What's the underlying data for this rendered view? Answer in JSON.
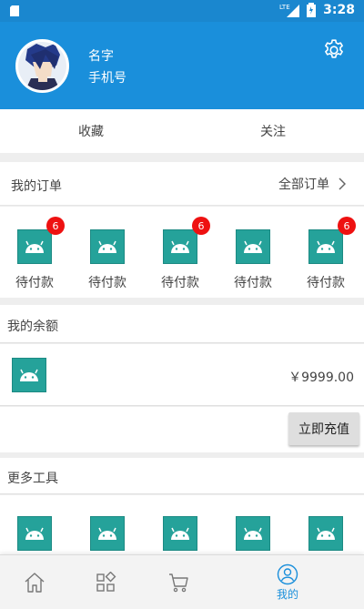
{
  "status_bar": {
    "time": "3:28",
    "network": "LTE"
  },
  "profile": {
    "name": "名字",
    "phone": "手机号"
  },
  "favorites": {
    "items": [
      "收藏",
      "关注"
    ]
  },
  "orders": {
    "title": "我的订单",
    "all_label": "全部订单",
    "items": [
      {
        "label": "待付款",
        "badge": "6"
      },
      {
        "label": "待付款",
        "badge": ""
      },
      {
        "label": "待付款",
        "badge": "6"
      },
      {
        "label": "待付款",
        "badge": ""
      },
      {
        "label": "待付款",
        "badge": "6"
      }
    ]
  },
  "balance": {
    "title": "我的余额",
    "amount": "￥9999.00",
    "recharge_label": "立即充值"
  },
  "tools": {
    "title": "更多工具",
    "count": 5
  },
  "tabbar": {
    "items": [
      {
        "icon": "home-icon",
        "label": ""
      },
      {
        "icon": "category-icon",
        "label": ""
      },
      {
        "icon": "cart-icon",
        "label": ""
      },
      {
        "icon": "profile-icon",
        "label": "我的",
        "active": true
      }
    ]
  },
  "colors": {
    "primary": "#1a8fdb",
    "badge": "#ee1111",
    "tile": "#25a29a"
  }
}
